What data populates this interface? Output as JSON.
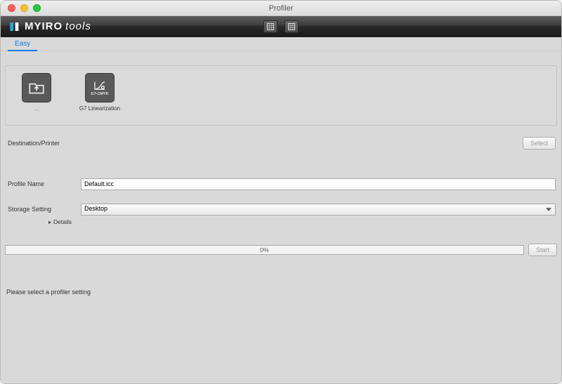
{
  "window": {
    "title": "Profiler"
  },
  "brand": {
    "bold": "MYIRO",
    "light": "tools"
  },
  "tabs": [
    {
      "label": "Easy",
      "active": true
    }
  ],
  "profile_items": [
    {
      "caption": "...",
      "is_add": true
    },
    {
      "caption": "G7 Linearization",
      "badge": "G7-CMYK",
      "is_add": false
    }
  ],
  "destination": {
    "label": "Destination/Printer",
    "select_btn": "Select"
  },
  "profile_name": {
    "label": "Profile Name",
    "value": "Default.icc"
  },
  "storage": {
    "label": "Storage Setting",
    "value": "Desktop",
    "details": "Details"
  },
  "progress": {
    "text": "0%",
    "start_btn": "Start"
  },
  "status": {
    "message": "Please select a profiler setting"
  }
}
